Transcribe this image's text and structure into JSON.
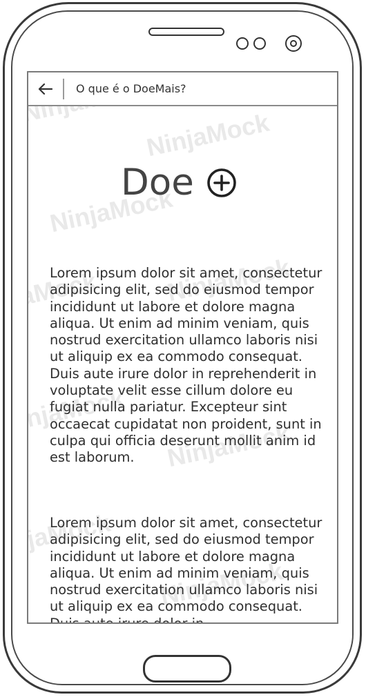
{
  "header": {
    "back_icon": "arrow-left-icon",
    "title": "O que é o DoeMais?"
  },
  "main": {
    "headline": "Doe",
    "headline_icon": "circle-plus-icon",
    "paragraphs": [
      "Lorem ipsum dolor sit amet, consectetur adipisicing elit, sed do eiusmod tempor incididunt ut labore et dolore magna aliqua. Ut enim ad minim veniam, quis nostrud exercitation ullamco laboris nisi ut aliquip ex ea commodo consequat. Duis aute irure dolor in reprehenderit in voluptate velit esse cillum dolore eu fugiat nulla pariatur. Excepteur sint occaecat cupidatat non proident, sunt in culpa qui officia deserunt mollit anim id est laborum.",
      "Lorem ipsum dolor sit amet, consectetur adipisicing elit, sed do eiusmod tempor incididunt ut labore et dolore magna aliqua. Ut enim ad minim veniam, quis nostrud exercitation ullamco laboris nisi ut aliquip ex ea commodo consequat. Duis aute irure dolor in"
    ]
  },
  "watermark": "NinjaMock",
  "colors": {
    "frame": "#3a3a3a",
    "text": "#2f2f2f",
    "divider": "#8a8a8a"
  }
}
